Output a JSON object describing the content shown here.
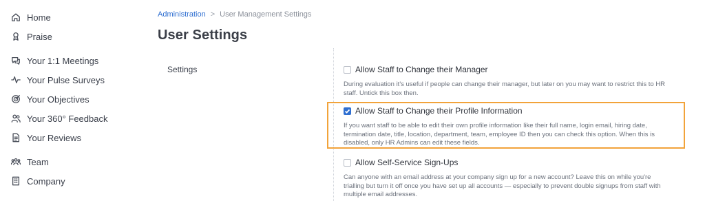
{
  "sidebar": {
    "items": [
      {
        "label": "Home",
        "icon": "home-icon"
      },
      {
        "label": "Praise",
        "icon": "praise-icon"
      },
      {
        "label": "Your 1:1 Meetings",
        "icon": "chat-icon"
      },
      {
        "label": "Your Pulse Surveys",
        "icon": "pulse-icon"
      },
      {
        "label": "Your Objectives",
        "icon": "target-icon"
      },
      {
        "label": "Your 360° Feedback",
        "icon": "people-icon"
      },
      {
        "label": "Your Reviews",
        "icon": "document-icon"
      },
      {
        "label": "Team",
        "icon": "team-icon"
      },
      {
        "label": "Company",
        "icon": "building-icon"
      }
    ]
  },
  "breadcrumb": {
    "parent": "Administration",
    "separator": ">",
    "current": "User Management Settings"
  },
  "page": {
    "title": "User Settings",
    "section_label": "Settings"
  },
  "options": [
    {
      "title": "Allow Staff to Change their Manager",
      "checked": false,
      "description": "During evaluation it's useful if people can change their manager, but later on you may want to restrict this to HR staff. Untick this box then."
    },
    {
      "title": "Allow Staff to Change their Profile Information",
      "checked": true,
      "description": "If you want staff to be able to edit their own profile information like their full name, login email, hiring date, termination date, title, location, department, team, employee ID then you can check this option. When this is disabled, only HR Admins can edit these fields."
    },
    {
      "title": "Allow Self-Service Sign-Ups",
      "checked": false,
      "description": "Can anyone with an email address at your company sign up for a new account? Leave this on while you're trialling but turn it off once you have set up all accounts — especially to prevent double signups from staff with multiple email addresses."
    }
  ],
  "colors": {
    "accent": "#2f6fd1",
    "highlight": "#f2a33a"
  }
}
